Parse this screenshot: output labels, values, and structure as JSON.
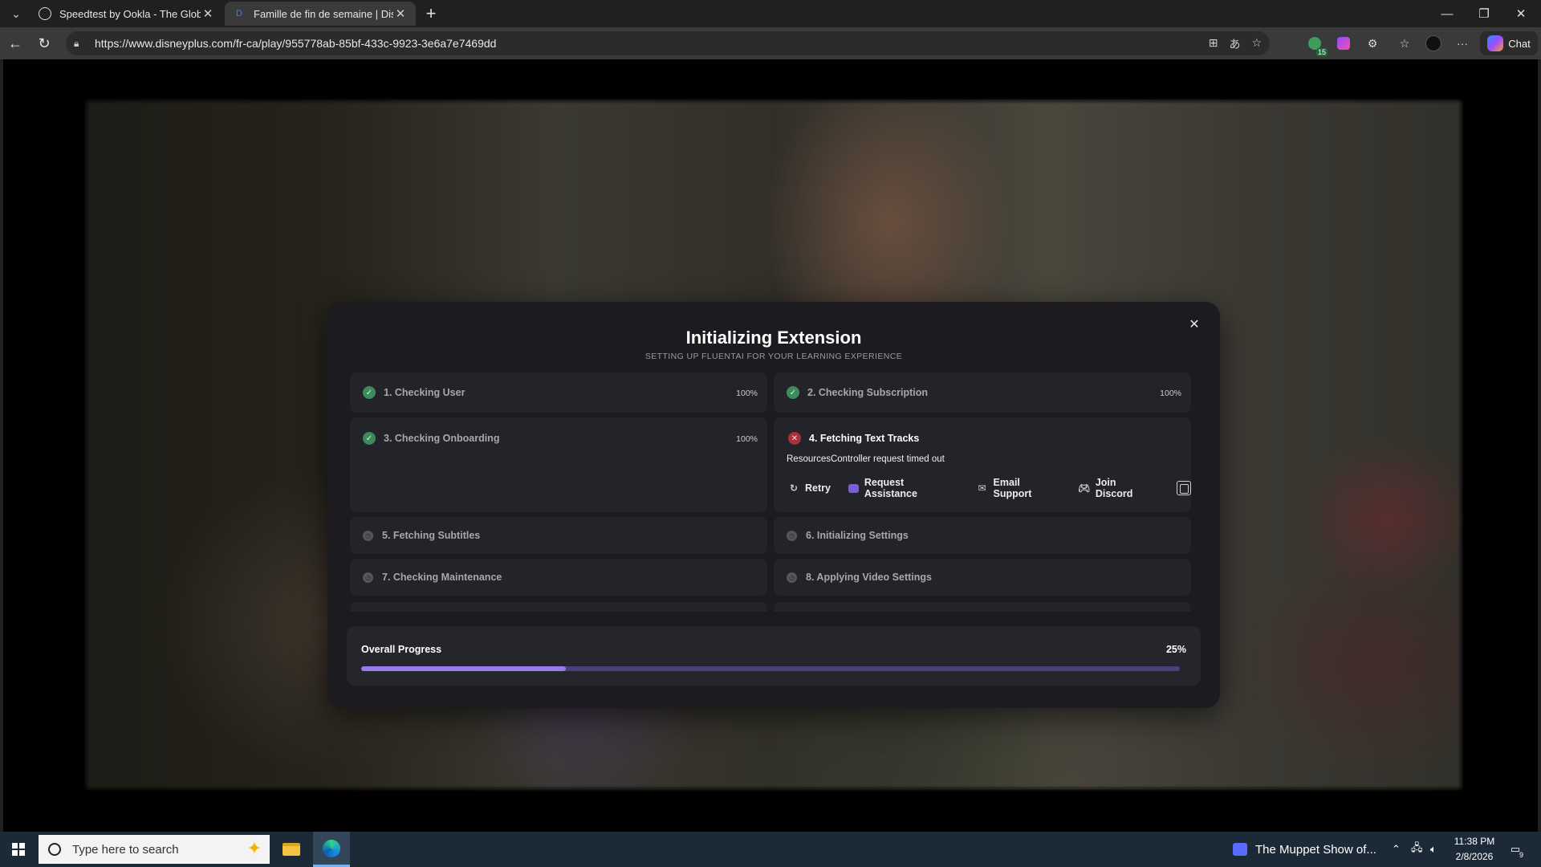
{
  "browser": {
    "tabs": [
      {
        "title": "Speedtest by Ookla - The Global I",
        "active": false
      },
      {
        "title": "Famille de fin de semaine | Disney",
        "active": true
      }
    ],
    "url": "https://www.disneyplus.com/fr-ca/play/955778ab-85bf-433c-9923-3e6a7e7469dd",
    "toolbar": {
      "extension_badge": "15",
      "chat_label": "Chat"
    }
  },
  "modal": {
    "title": "Initializing Extension",
    "subtitle": "SETTING UP FLUENTAI FOR YOUR LEARNING EXPERIENCE",
    "steps": [
      {
        "label": "1. Checking User",
        "status": "done",
        "percent": "100%"
      },
      {
        "label": "2. Checking Subscription",
        "status": "done",
        "percent": "100%"
      },
      {
        "label": "3. Checking Onboarding",
        "status": "done",
        "percent": "100%"
      },
      {
        "label": "4. Fetching Text Tracks",
        "status": "error",
        "error": "ResourcesController request timed out"
      },
      {
        "label": "5. Fetching Subtitles",
        "status": "pending"
      },
      {
        "label": "6. Initializing Settings",
        "status": "pending"
      },
      {
        "label": "7. Checking Maintenance",
        "status": "pending"
      },
      {
        "label": "8. Applying Video Settings",
        "status": "pending"
      }
    ],
    "actions": {
      "retry": "Retry",
      "request_assistance": "Request Assistance",
      "email_support": "Email Support",
      "join_discord": "Join Discord"
    },
    "progress": {
      "label": "Overall Progress",
      "percent_text": "25%",
      "value": 0.25,
      "fill_color": "#9b7af0",
      "track_color": "#4a3f79"
    },
    "status_colors": {
      "done": "#3d8a5a",
      "error": "#a8323a",
      "pending": "#55555c"
    }
  },
  "taskbar": {
    "search_placeholder": "Type here to search",
    "media_title": "The Muppet Show of...",
    "time": "11:38 PM",
    "date": "2/8/2026",
    "notification_count": "9"
  }
}
